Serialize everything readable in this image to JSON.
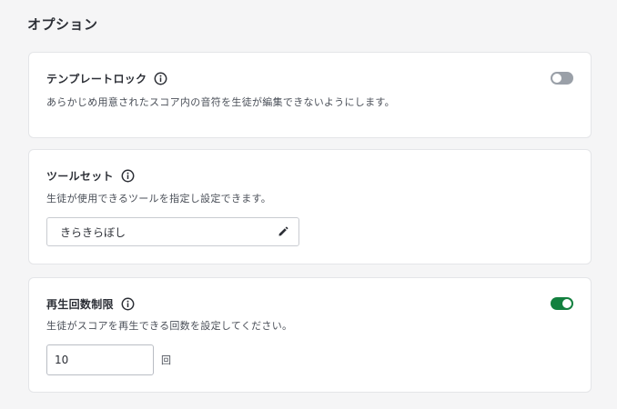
{
  "section": {
    "title": "オプション"
  },
  "template_lock": {
    "title": "テンプレートロック",
    "description": "あらかじめ用意されたスコア内の音符を生徒が編集できないようにします。",
    "enabled": false
  },
  "toolset": {
    "title": "ツールセット",
    "description": "生徒が使用できるツールを指定し設定できます。",
    "selected": "きらきらぼし"
  },
  "playback_limit": {
    "title": "再生回数制限",
    "description": "生徒がスコアを再生できる回数を設定してください。",
    "enabled": true,
    "count": "10",
    "unit": "回"
  },
  "colors": {
    "toggle_on": "#13803f",
    "toggle_off": "#9aa0a8",
    "background": "#f5f5f6"
  },
  "icons": {
    "info": "info-icon",
    "edit": "pencil-icon"
  }
}
